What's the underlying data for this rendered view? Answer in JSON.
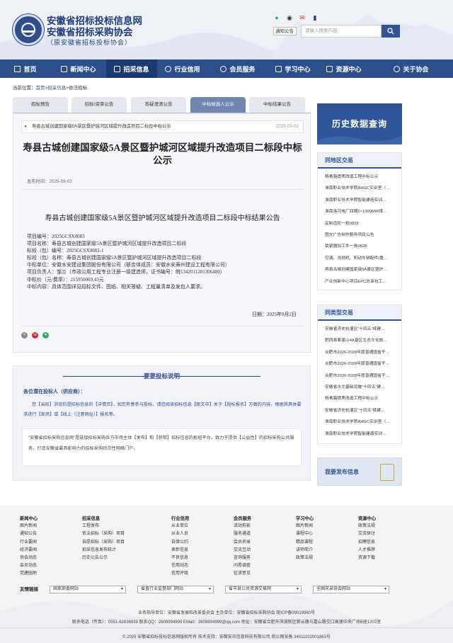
{
  "header": {
    "title1": "安徽省招标投标信息网",
    "title2": "安徽省招标采购协会",
    "title3": "（原安徽省招标投标协会）",
    "search": {
      "select": "通知公告",
      "placeholder": "请输入搜索内容"
    }
  },
  "nav": {
    "items": [
      "首页",
      "新闻中心",
      "招采信息",
      "行业信用",
      "会员服务",
      "学习中心",
      "资源中心",
      "关于协会"
    ],
    "active": "招采信息"
  },
  "breadcrumb": {
    "label": "当前位置：",
    "home": "首页",
    "sep1": ">",
    "section": "招采信息",
    "sep2": ">",
    "current": "依法招标"
  },
  "tabs": [
    "招标预告",
    "招标/资审公告",
    "答疑澄清公告",
    "中标候选人公示",
    "中标结果公告"
  ],
  "article": {
    "crumb_title": "寿县古城创建国家级5A景区暨护城河区域提升改造项目二标段中标公示",
    "crumb_date": "2025-09-02",
    "title_line1": "寿县古城创建国家级5A景区暨护城河区域提升改造项目二标段中标",
    "title_line2": "公示",
    "publish": "发布时间：2025-09-02",
    "subtitle": "寿县古城创建国家级5A景区暨护城河区域提升改造项目二标段中标结果公告",
    "lines": [
      "项目编号：2025GCSX0083",
      "项目名称：寿县古城创建国家级5A景区暨护城河区域提升改造项目二标段",
      "标段（包）编号：2025GCSX0083-1",
      "标段（包）名称：寿县古城创建国家级5A景区暨护城河区域提升改造项目二标段",
      "中标单位：安徽水安建设集团股份有限公司（联合体成员：安徽水安寿州建设工程有限公司）",
      "项目负责人：邹兰（市政公用工程专业注册一级建造师，证书编号：皖1342011201306480）",
      "中标价（元/费率）：215950069.43元",
      "中标内容：具体范围详见招标文件、图纸、相关答疑、工程量清单及发包人要求。"
    ],
    "sign_date": "日期：2025年9月2日"
  },
  "tips": {
    "title": "要要投标说明",
    "to": "各位潜在投标人（供应商）：",
    "p1": "您【当前】浏览的是招标信息的【详情页】，如您有意参与投标，请您阅读招标信息【原文中】关于【投标报名】方面的内容，根据其具体要求进行【现场】或【线上（注意网址）】报名等。",
    "p2": "“安徽省招标采购信息网”是链接招标采购各方市场主体【发布】和【获取】招标信息的枢纽平台，致力于提供【公益性】的招标采购公共服务，打造安徽省最具影响力的招标采购综合性网络门户。"
  },
  "sidebar": {
    "history": "历史数据查询",
    "region_title": "同地区交易",
    "region_items": [
      "杨青路提质改造工程中标公示",
      "淮南职业技术学院AHGC实训室（…",
      "淮南职业技术学院智能建造实训…",
      "淮南洛河电厂四期2×1000MW煤…",
      "定制齿轮一批0828",
      "图文广告制作服务项目公告",
      "锁紧器加工件一批0828",
      "空调、洗地机、机动车辆配件(重…",
      "寿县古城创建国家级5A景区暨护…",
      "产业创新中心项目EPC总承包工…"
    ],
    "similar_title": "同类型交易",
    "similar_items": [
      "安徽省济史杭灌区“十四五”续建…",
      "肥西县紫蓬山4A景区生态文化旅…",
      "合肥市2026-2028年度普通国省干…",
      "合肥市2026-2028年度普通国省干…",
      "合肥市2026-2028年度普通国省干…",
      "安徽省水文基础设施“十四五”建…",
      "杨青路提质改造工程中标公示",
      "安徽省济史杭灌区“十四五”续建…",
      "淮南职业技术学院AHGC实训室（…",
      "淮南职业技术学院智能建造实训…"
    ],
    "publish": "我要发布信息"
  },
  "footer": {
    "cols": [
      {
        "head": "新闻中心",
        "items": [
          "图片新闻",
          "通知公告",
          "行业要闻",
          "经济要闻",
          "协会动态",
          "会员动态",
          "党建园地"
        ]
      },
      {
        "head": "招采信息",
        "items": [
          "工程发布",
          "依法招标（采购）项目",
          "自愿招标（采购）项目",
          "招采信息发布统计",
          "历史公告公示"
        ]
      },
      {
        "head": "行业信用",
        "items": [
          "从业单位",
          "从业人员",
          "自律公约",
          "表彰信息",
          "不良信息",
          "信用动态",
          "信用评级"
        ]
      },
      {
        "head": "会员服务",
        "items": [
          "活动剪影",
          "服务通道",
          "会员名录",
          "交流互动",
          "咨询服务",
          "问卷调查",
          "征求意见"
        ]
      },
      {
        "head": "学习中心",
        "items": [
          "图片新闻",
          "课程中心",
          "精品课程",
          "讲师简介",
          "政策法规"
        ]
      },
      {
        "head": "资源中心",
        "items": [
          "政策法规",
          "交流探讨",
          "招聘信息",
          "人才推荐",
          "资源下载"
        ]
      }
    ],
    "links_label": "友情链接",
    "link_selects": [
      "国家部委网站",
      "省直行业监督部门网站",
      "省市县公共资源交易网",
      "全国兄弟协会网站"
    ],
    "line1": "业务指导单位：安徽省发展和改革委员会    主办单位：安徽省招标采购协会    皖ICP备09019960号",
    "line2": "联系电话（传真）：0551-62636939    联系QQ：2609994999    EMail：2609994999@qq.com    地址：安徽省合肥市滨湖新区紫云路与嘉山路交口高速中央广场B座1203室",
    "line3": "© 2025    安徽省招标投标信息网版权所有    技术支持：安徽安讯信息科技有限公司    皖公网安备 34011102001863号"
  },
  "colors": {
    "primary": "#2c4f8c",
    "nav_active": "#1d3a70",
    "tab_active": "#6f86b0"
  }
}
